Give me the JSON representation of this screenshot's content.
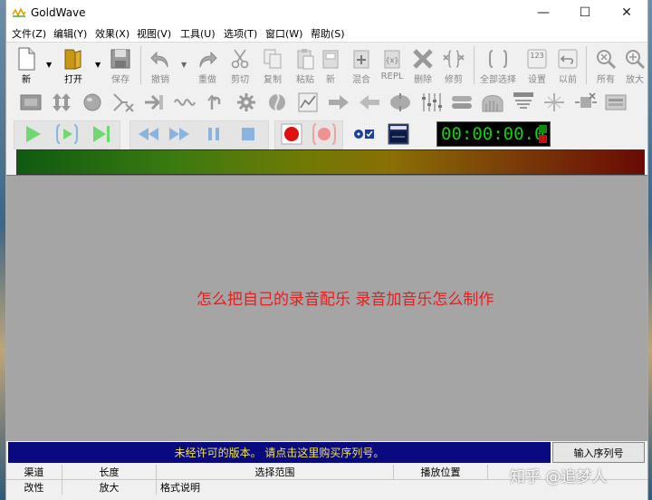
{
  "window": {
    "title": "GoldWave",
    "controls": {
      "minimize": "—",
      "maximize": "☐",
      "close": "✕"
    }
  },
  "menu": [
    "文件(Z)",
    "编辑(Y)",
    "效果(X)",
    "视图(V)",
    "工具(U)",
    "选项(T)",
    "窗口(W)",
    "帮助(S)"
  ],
  "toolbar": {
    "new": "新",
    "open": "打开",
    "save": "保存",
    "undo": "撤销",
    "redo": "重做",
    "cut": "剪切",
    "copy": "复制",
    "paste": "粘贴",
    "paste_new": "新",
    "mix": "混合",
    "replace": "REPL",
    "delete": "删除",
    "trim": "修剪",
    "select_all": "全部选择",
    "set": "设置",
    "previous": "以前",
    "all": "所有",
    "zoom_in": "放大"
  },
  "timer": {
    "display": "00:00:00.0"
  },
  "workspace": {
    "overlay_text": "怎么把自己的录音配乐 录音加音乐怎么制作"
  },
  "registration": {
    "message": "未经许可的版本。 请点击这里购买序列号。",
    "button": "输入序列号"
  },
  "status": {
    "row1": [
      "渠道",
      "长度",
      "选择范围",
      "播放位置"
    ],
    "row2": [
      "改性",
      "放大",
      "格式说明"
    ]
  },
  "watermark": "知乎 @追梦人",
  "colors": {
    "reg_bar_bg": "#0a0a80",
    "reg_bar_text": "#f4e64a",
    "overlay_text": "#e02020",
    "timer_digits": "#10d010",
    "workspace_bg": "#a5a5a5"
  }
}
